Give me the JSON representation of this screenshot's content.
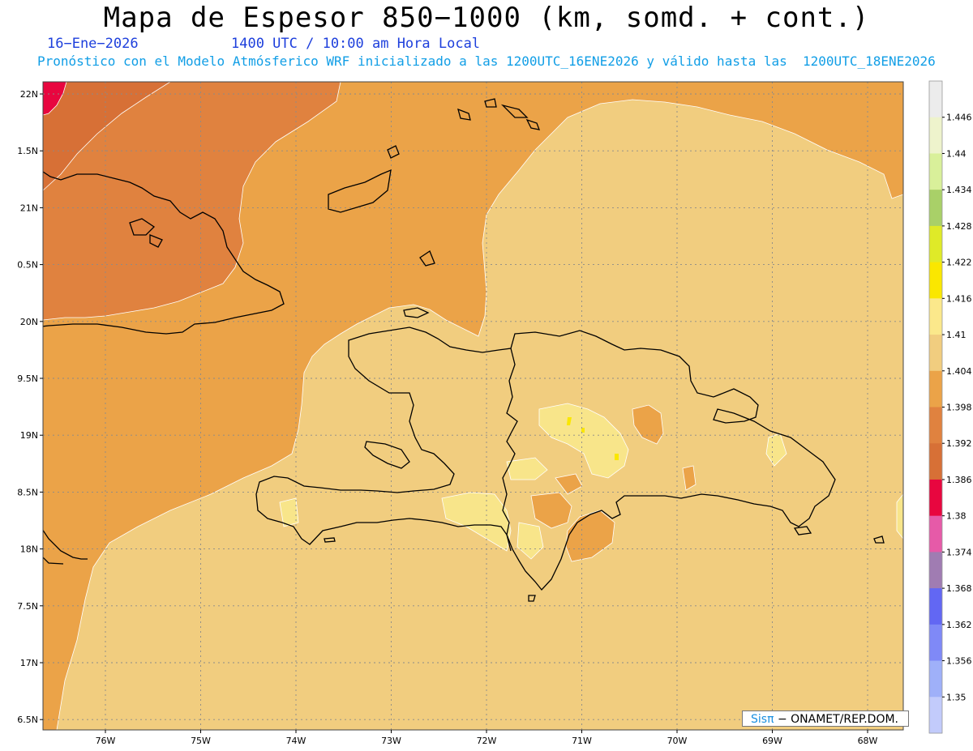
{
  "header": {
    "title": "Mapa de Espesor 850−1000 (km, somd. + cont.)",
    "date": "16−Ene−2026",
    "time": "1400 UTC / 10:00 am Hora Local",
    "forecast": "Pronóstico con el Modelo Atmósferico WRF inicializado a las 1200UTC_16ENE2026 y válido hasta las  1200UTC_18ENE2026"
  },
  "map": {
    "lat_labels": [
      "22N",
      "1.5N",
      "21N",
      "0.5N",
      "20N",
      "9.5N",
      "19N",
      "8.5N",
      "18N",
      "7.5N",
      "17N",
      "6.5N"
    ],
    "lon_labels": [
      "76W",
      "75W",
      "74W",
      "73W",
      "72W",
      "71W",
      "70W",
      "69W",
      "68W"
    ],
    "colors": {
      "c1392": "#e0823f",
      "c1398": "#eba348",
      "c1404": "#f1cd7f",
      "c1410": "#f8e58a",
      "c1386": "#d77036",
      "c1380": "#e8063f"
    }
  },
  "colorbar": {
    "labels": [
      "1.446",
      "1.44",
      "1.434",
      "1.428",
      "1.422",
      "1.416",
      "1.41",
      "1.404",
      "1.398",
      "1.392",
      "1.386",
      "1.38",
      "1.374",
      "1.368",
      "1.362",
      "1.356",
      "1.35"
    ],
    "colors": [
      "#ececec",
      "#eef3cc",
      "#d9f09a",
      "#a9d068",
      "#dfea28",
      "#fae700",
      "#fbe88b",
      "#f1cd7f",
      "#eba348",
      "#e0823f",
      "#d77036",
      "#e8063f",
      "#e65aa8",
      "#a07cb2",
      "#6267f3",
      "#7f89f7",
      "#9fb0f9",
      "#c2cbfb"
    ]
  },
  "credit": {
    "sis": "Sisπ",
    "org": " − ONAMET/REP.DOM."
  }
}
